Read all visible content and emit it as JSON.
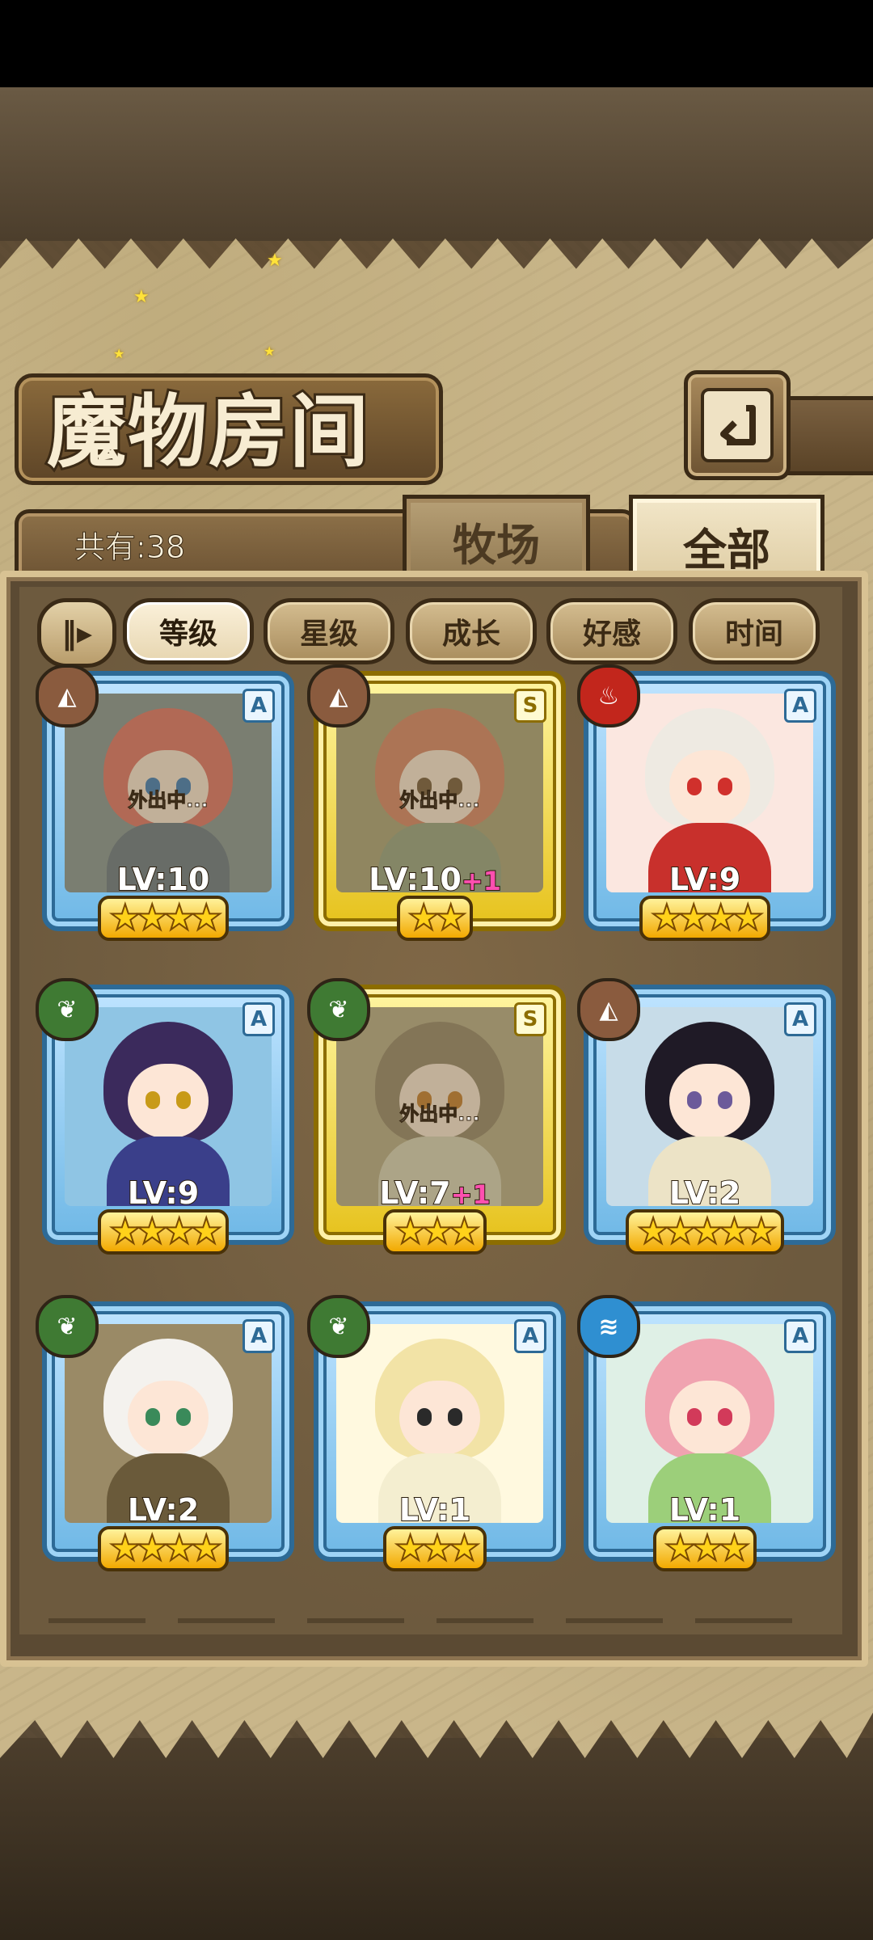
{
  "screen": {
    "title": "魔物房间",
    "count_label": "共有:38",
    "tabs": [
      {
        "label": "牧场",
        "selected": false
      },
      {
        "label": "全部",
        "selected": true
      }
    ],
    "sort_toggle_icon": "sort-order-icon",
    "sort_buttons": [
      {
        "label": "等级",
        "active": true
      },
      {
        "label": "星级",
        "active": false
      },
      {
        "label": "成长",
        "active": false
      },
      {
        "label": "好感",
        "active": false
      },
      {
        "label": "时间",
        "active": false
      }
    ]
  },
  "colors": {
    "parchment": "#c9b68a",
    "frame_blue": "#6fb8e6",
    "frame_gold": "#e6c21c",
    "plus_pink": "#ff4fb0"
  },
  "monsters": [
    {
      "element": "earth",
      "rank": "A",
      "level": "LV:10",
      "plus": "",
      "stars": "★★★★",
      "star_count": 4,
      "away": "外出中...",
      "frame": "blue"
    },
    {
      "element": "earth",
      "rank": "S",
      "level": "LV:10",
      "plus": "+1",
      "stars": "★★",
      "star_count": 2,
      "away": "外出中...",
      "frame": "gold"
    },
    {
      "element": "fire",
      "rank": "A",
      "level": "LV:9",
      "plus": "",
      "stars": "★★★★",
      "star_count": 4,
      "away": "",
      "frame": "blue"
    },
    {
      "element": "grass",
      "rank": "A",
      "level": "LV:9",
      "plus": "",
      "stars": "★★★★",
      "star_count": 4,
      "away": "",
      "frame": "blue"
    },
    {
      "element": "grass",
      "rank": "S",
      "level": "LV:7",
      "plus": "+1",
      "stars": "★★★",
      "star_count": 3,
      "away": "外出中...",
      "frame": "gold"
    },
    {
      "element": "earth",
      "rank": "A",
      "level": "LV:2",
      "plus": "",
      "stars": "★★★★★",
      "star_count": 5,
      "away": "",
      "frame": "blue"
    },
    {
      "element": "grass",
      "rank": "A",
      "level": "LV:2",
      "plus": "",
      "stars": "★★★★",
      "star_count": 4,
      "away": "",
      "frame": "blue"
    },
    {
      "element": "grass",
      "rank": "A",
      "level": "LV:1",
      "plus": "",
      "stars": "★★★",
      "star_count": 3,
      "away": "",
      "frame": "blue"
    },
    {
      "element": "water",
      "rank": "A",
      "level": "LV:1",
      "plus": "",
      "stars": "★★★",
      "star_count": 3,
      "away": "",
      "frame": "blue"
    }
  ]
}
